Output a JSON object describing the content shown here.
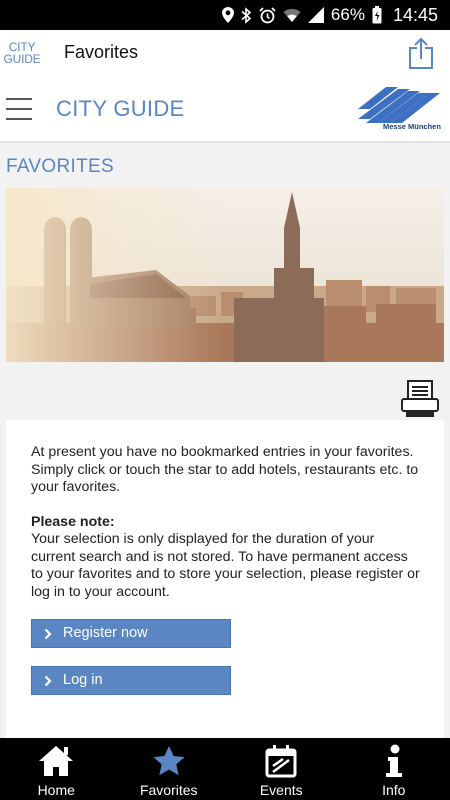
{
  "status": {
    "battery": "66%",
    "time": "14:45"
  },
  "app_bar": {
    "logo_line1": "CITY",
    "logo_line2": "GUIDE",
    "title": "Favorites"
  },
  "header": {
    "title": "CITY GUIDE",
    "logo_caption": "Messe München"
  },
  "section": {
    "title": "FAVORITES"
  },
  "content": {
    "intro": "At present you have no bookmarked entries in your favorites. Simply click or touch the star to add hotels, restaurants etc. to your favorites.",
    "note_label": "Please note:",
    "note_text": "Your selection is only displayed for the duration of your current search and is not stored. To have permanent access to your favorites and to store your selection, please register or log in to your account.",
    "register_label": "Register now",
    "login_label": "Log in"
  },
  "nav": {
    "items": [
      {
        "label": "Home",
        "icon": "home-icon"
      },
      {
        "label": "Favorites",
        "icon": "star-icon",
        "active": true
      },
      {
        "label": "Events",
        "icon": "calendar-icon"
      },
      {
        "label": "Info",
        "icon": "info-icon"
      }
    ]
  },
  "colors": {
    "accent": "#5a86c4",
    "nav_bg": "#000000",
    "active_icon": "#5a86c4"
  }
}
